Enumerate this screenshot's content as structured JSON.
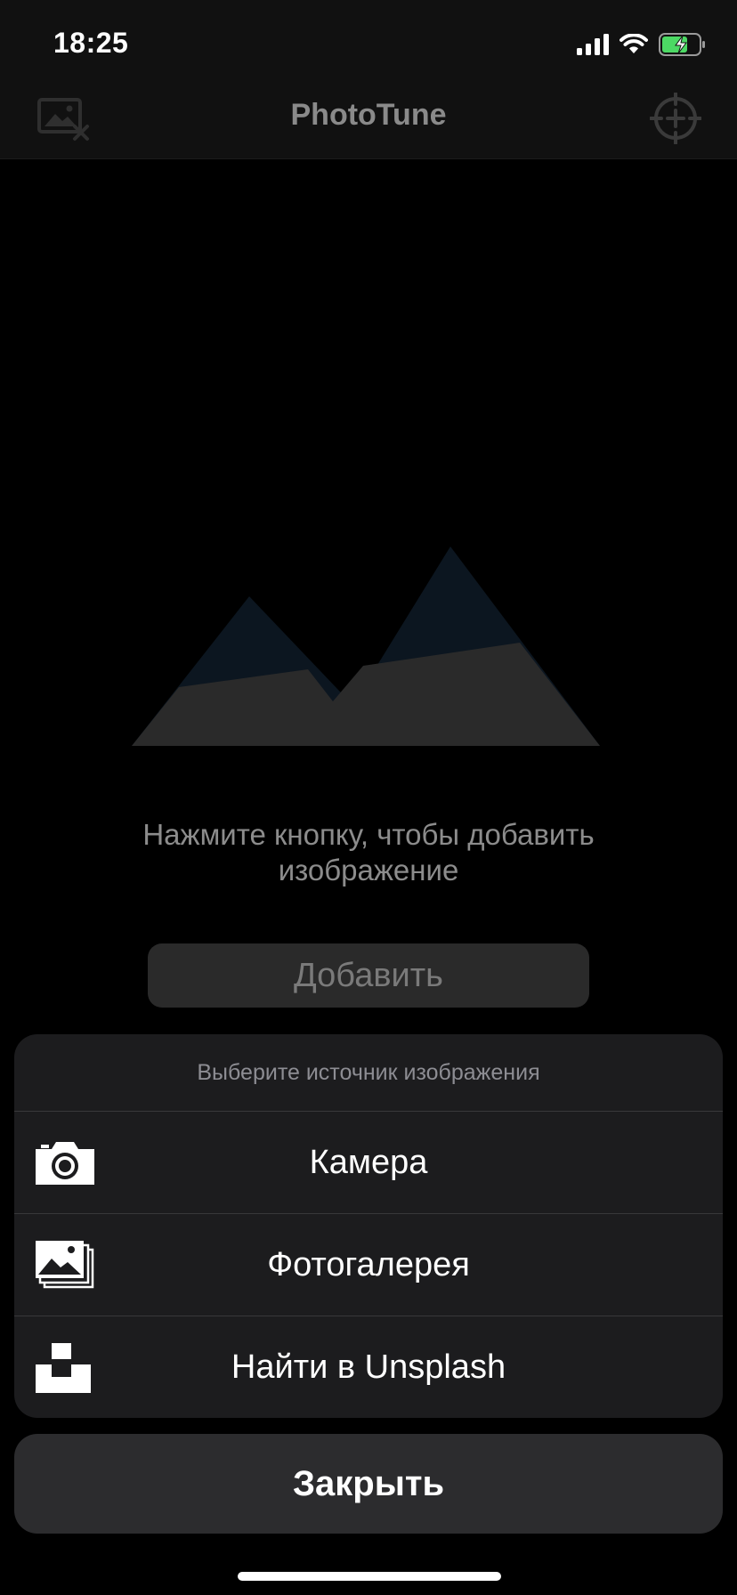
{
  "status_bar": {
    "time": "18:25",
    "icons": [
      "cellular-signal-icon",
      "wifi-icon",
      "battery-charging-icon"
    ]
  },
  "nav": {
    "title": "PhotoTune",
    "left_icon": "remove-image-icon",
    "right_icon": "crosshair-icon"
  },
  "empty_state": {
    "illustration": "mountains-icon",
    "prompt": "Нажмите кнопку, чтобы добавить изображение",
    "add_label": "Добавить"
  },
  "action_sheet": {
    "title": "Выберите источник изображения",
    "options": [
      {
        "label": "Камера",
        "icon": "camera-icon"
      },
      {
        "label": "Фотогалерея",
        "icon": "photo-gallery-icon"
      },
      {
        "label": "Найти в Unsplash",
        "icon": "unsplash-icon"
      }
    ],
    "close_label": "Закрыть"
  },
  "colors": {
    "background": "#000000",
    "bar": "#111111",
    "sheet": "#1c1c1e",
    "battery_fill": "#4cd964",
    "mountain_dark": "#0c1620",
    "mountain_grey": "#2a2a2a"
  }
}
